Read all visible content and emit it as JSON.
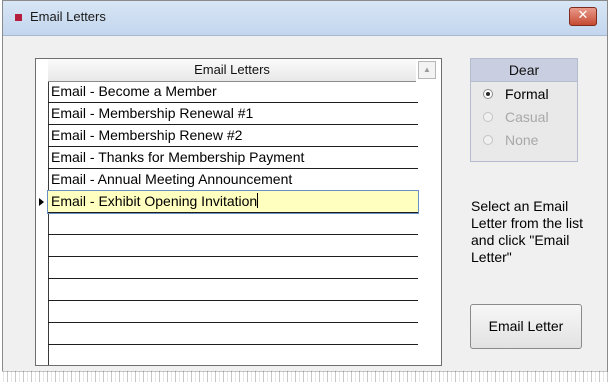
{
  "window": {
    "title": "Email Letters",
    "close_glyph": "✕",
    "accent_color": "#b51f3d"
  },
  "list": {
    "header": "Email Letters",
    "rows": [
      "Email - Become a Member",
      "Email - Membership Renewal #1",
      "Email - Membership Renew #2",
      "Email - Thanks for Membership Payment",
      "Email - Annual Meeting Announcement",
      "Email - Exhibit Opening Invitation",
      "",
      "",
      "",
      "",
      "",
      "",
      ""
    ],
    "selected_index": 5,
    "scroll_icon": "scroll-up-arrow-icon"
  },
  "dear": {
    "title": "Dear",
    "options": [
      "Formal",
      "Casual",
      "None"
    ],
    "selected": "Formal"
  },
  "hint": "Select an Email Letter from the list and click \"Email Letter\"",
  "email_button": "Email Letter"
}
